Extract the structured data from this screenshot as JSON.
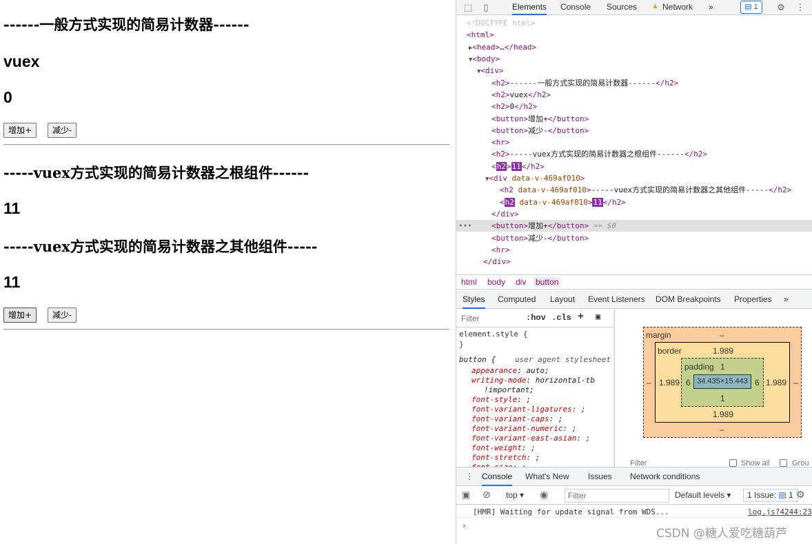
{
  "page": {
    "h2_1": "------一般方式实现的简易计数器------",
    "h2_2": "vuex",
    "h2_3": "0",
    "btn_inc": "增加+",
    "btn_dec": "减少-",
    "h2_4": "-----vuex方式实现的简易计数器之根组件------",
    "h2_5": "11",
    "h2_6": "-----vuex方式实现的简易计数器之其他组件-----",
    "h2_7": "11",
    "btn_inc2": "增加+",
    "btn_dec2": "减少-"
  },
  "devtools": {
    "tabs": [
      "Elements",
      "Console",
      "Sources",
      "Network"
    ],
    "more": "»",
    "issues_count": "1",
    "dom": {
      "l0": "<!DOCTYPE html>",
      "l1": "<html>",
      "l2_tag": "<head>",
      "l2_ellipsis": "…",
      "l2_close": "</head>",
      "l3": "<body>",
      "l4": "<div>",
      "l5_text": "------一般方式实现的简易计数器------",
      "l6_text": "vuex",
      "l7_text": "0",
      "l8_text": "增加+",
      "l9_text": "减少-",
      "l10": "<hr>",
      "l11_text": "-----vuex方式实现的简易计数器之根组件------",
      "l12_text": "11",
      "l13_attr": "data-v-469af010",
      "l14_text": "-----vuex方式实现的简易计数器之其他组件-----",
      "l15_text": "11",
      "l16": "</div>",
      "l17_text": "增加+",
      "l17_eq": "== $0",
      "l18_text": "减少-",
      "l19": "<hr>",
      "l20": "</div>"
    },
    "crumbs": [
      "html",
      "body",
      "div",
      "button"
    ],
    "subtabs": [
      "Styles",
      "Computed",
      "Layout",
      "Event Listeners",
      "DOM Breakpoints",
      "Properties"
    ],
    "styles": {
      "filter_placeholder": "Filter",
      "hov": ":hov",
      "cls": ".cls",
      "element_style": "element.style {",
      "close_brace": "}",
      "button_selector": "button {",
      "ua": "user agent stylesheet",
      "props": [
        {
          "name": "appearance",
          "value": "auto;"
        },
        {
          "name": "writing-mode",
          "value": "horizontal-tb"
        },
        {
          "name": "",
          "value": "!important;"
        },
        {
          "name": "font-style",
          "value": ";"
        },
        {
          "name": "font-variant-ligatures",
          "value": ";"
        },
        {
          "name": "font-variant-caps",
          "value": ";"
        },
        {
          "name": "font-variant-numeric",
          "value": ";"
        },
        {
          "name": "font-variant-east-asian",
          "value": ";"
        },
        {
          "name": "font-weight",
          "value": ";"
        },
        {
          "name": "font-stretch",
          "value": ";"
        },
        {
          "name": "font-size",
          "value": ";"
        }
      ]
    },
    "boxmodel": {
      "margin_label": "margin",
      "margin_top": "–",
      "margin_bottom": "–",
      "margin_left": "–",
      "margin_right": "–",
      "border_label": "border",
      "border_top": "1.989",
      "border_bottom": "1.989",
      "border_left": "1.989",
      "border_right": "1.989",
      "padding_label": "padding",
      "padding_top": "1",
      "padding_bottom": "1",
      "padding_left": "6",
      "padding_right": "6",
      "content": "34.435×15.443",
      "filter_text": "Filter",
      "show_all": "Show all",
      "group": "Grou"
    },
    "drawer": {
      "tabs": [
        "Console",
        "What's New",
        "Issues",
        "Network conditions"
      ],
      "context": "top",
      "filter_placeholder": "Filter",
      "levels": "Default levels",
      "issue_text": "1 Issue:",
      "issue_count": "1",
      "message": "[HMR] Waiting for update signal from WDS...",
      "source": "log.js?4244:23"
    },
    "watermark": "CSDN @糖人爱吃糖葫芦"
  }
}
